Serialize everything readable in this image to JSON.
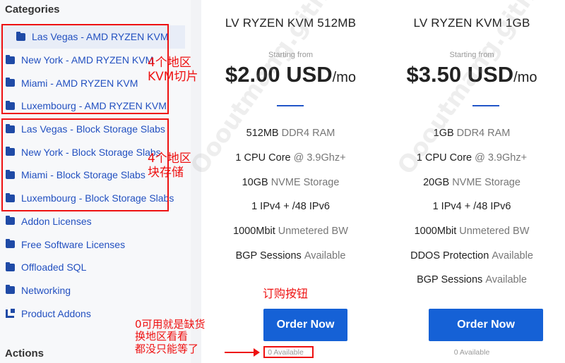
{
  "sidebar": {
    "title": "Categories",
    "actions_title": "Actions",
    "items": [
      {
        "label": "Las Vegas - AMD RYZEN KVM",
        "icon": "folder-icon",
        "active": true
      },
      {
        "label": "New York - AMD RYZEN KVM",
        "icon": "folder-icon"
      },
      {
        "label": "Miami - AMD RYZEN KVM",
        "icon": "folder-icon"
      },
      {
        "label": "Luxembourg - AMD RYZEN KVM",
        "icon": "folder-icon"
      },
      {
        "label": "Las Vegas - Block Storage Slabs",
        "icon": "folder-icon"
      },
      {
        "label": "New York - Block Storage Slabs",
        "icon": "folder-icon"
      },
      {
        "label": "Miami - Block Storage Slabs",
        "icon": "folder-icon"
      },
      {
        "label": "Luxembourg - Block Storage Slabs",
        "icon": "folder-icon"
      },
      {
        "label": "Addon Licenses",
        "icon": "folder-icon"
      },
      {
        "label": "Free Software Licenses",
        "icon": "folder-icon"
      },
      {
        "label": "Offloaded SQL",
        "icon": "folder-icon"
      },
      {
        "label": "Networking",
        "icon": "folder-icon"
      },
      {
        "label": "Product Addons",
        "icon": "addons-icon"
      }
    ]
  },
  "annotations": {
    "kvm_note": "4个地区\nKVM切片",
    "storage_note": "4个地区\n块存储",
    "order_note": "订购按钮",
    "stock_note": "0可用就是缺货\n换地区看看\n都没只能等了"
  },
  "watermark": "Oooutmang.github.io",
  "products": [
    {
      "name": "LV RYZEN KVM 512MB",
      "starting_from": "Starting from",
      "price": "$2.00 USD",
      "unit": "/mo",
      "features": [
        {
          "strong": "512MB",
          "muted": "DDR4 RAM"
        },
        {
          "strong": "1 CPU Core",
          "muted": "@ 3.9Ghz+"
        },
        {
          "strong": "10GB",
          "muted": "NVME Storage"
        },
        {
          "strong": "1 IPv4 + /48 IPv6",
          "muted": ""
        },
        {
          "strong": "1000Mbit",
          "muted": "Unmetered BW"
        },
        {
          "strong": "BGP Sessions",
          "muted": "Available"
        }
      ],
      "order_label": "Order Now",
      "availability": "0 Available"
    },
    {
      "name": "LV RYZEN KVM 1GB",
      "starting_from": "Starting from",
      "price": "$3.50 USD",
      "unit": "/mo",
      "features": [
        {
          "strong": "1GB",
          "muted": "DDR4 RAM"
        },
        {
          "strong": "1 CPU Core",
          "muted": "@ 3.9Ghz+"
        },
        {
          "strong": "20GB",
          "muted": "NVME Storage"
        },
        {
          "strong": "1 IPv4 + /48 IPv6",
          "muted": ""
        },
        {
          "strong": "1000Mbit",
          "muted": "Unmetered BW"
        },
        {
          "strong": "DDOS Protection",
          "muted": "Available"
        },
        {
          "strong": "BGP Sessions",
          "muted": "Available"
        }
      ],
      "order_label": "Order Now",
      "availability": "0 Available"
    }
  ],
  "colors": {
    "accent": "#1561d6",
    "link": "#2250c0",
    "annotation": "#ee1111"
  }
}
